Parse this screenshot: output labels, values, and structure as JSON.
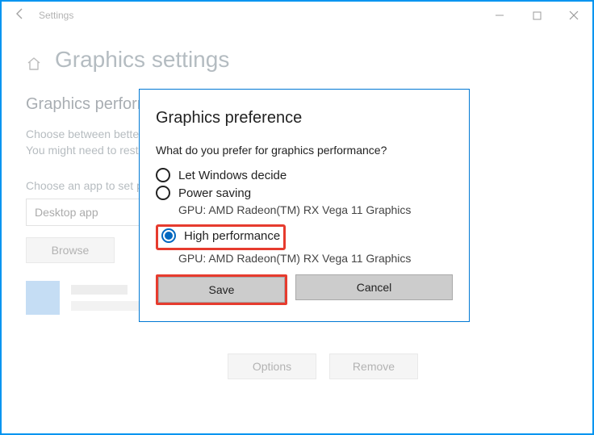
{
  "window": {
    "title": "Settings"
  },
  "page": {
    "heading": "Graphics settings",
    "subheading": "Graphics performance preference",
    "description": "Choose between better performance or longer battery life when using an app. You might need to restart the app for your changes to take effect.",
    "choose_label": "Choose an app to set preference",
    "select_value": "Desktop app",
    "browse": "Browse",
    "options_btn": "Options",
    "remove_btn": "Remove"
  },
  "dialog": {
    "title": "Graphics preference",
    "question": "What do you prefer for graphics performance?",
    "opt1": "Let Windows decide",
    "opt2": "Power saving",
    "opt2_gpu": "GPU: AMD Radeon(TM) RX Vega 11 Graphics",
    "opt3": "High performance",
    "opt3_gpu": "GPU: AMD Radeon(TM) RX Vega 11 Graphics",
    "save": "Save",
    "cancel": "Cancel"
  }
}
